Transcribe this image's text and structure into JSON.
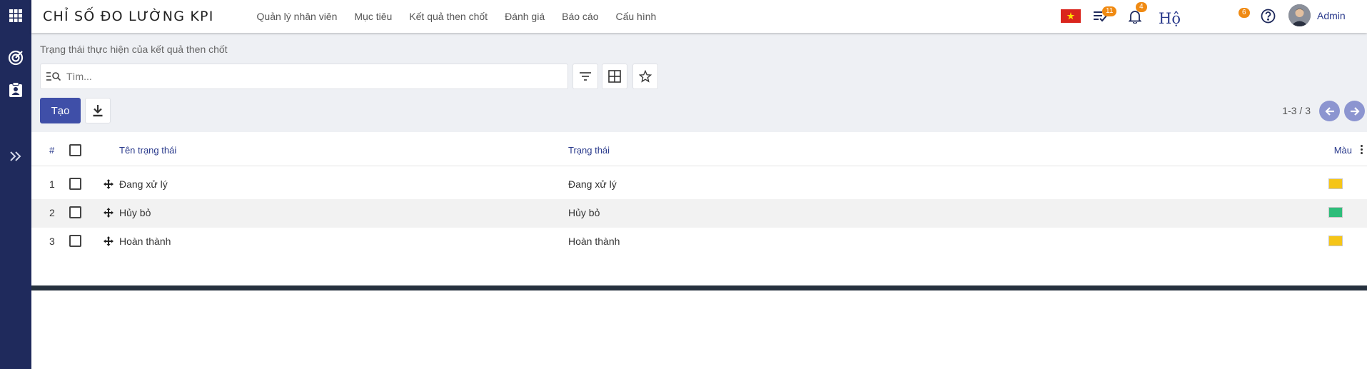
{
  "app_title": "CHỈ SỐ ĐO LƯỜNG KPI",
  "menu": [
    {
      "label": "Quản lý nhân viên"
    },
    {
      "label": "Mục tiêu"
    },
    {
      "label": "Kết quả then chốt"
    },
    {
      "label": "Đánh giá"
    },
    {
      "label": "Báo cáo"
    },
    {
      "label": "Cấu hình"
    }
  ],
  "topbar": {
    "activities_badge": "11",
    "notifications_badge": "4",
    "extra_text": "Hộ",
    "extra_badge": "6",
    "user_name": "Admin"
  },
  "breadcrumb": "Trạng thái thực hiện của kết quả then chốt",
  "search": {
    "placeholder": "Tìm...",
    "value": ""
  },
  "create_label": "Tạo",
  "pager": {
    "text": "1-3 / 3"
  },
  "columns": {
    "index": "#",
    "name": "Tên trạng thái",
    "state": "Trạng thái",
    "color": "Màu"
  },
  "rows": [
    {
      "index": "1",
      "name": "Đang xử lý",
      "state": "Đang xử lý",
      "color": "#f5c518"
    },
    {
      "index": "2",
      "name": "Hủy bỏ",
      "state": "Hủy bỏ",
      "color": "#2ebd7a"
    },
    {
      "index": "3",
      "name": "Hoàn thành",
      "state": "Hoàn thành",
      "color": "#f5c518"
    }
  ],
  "colors": {
    "sidebar": "#1f2a5c",
    "primary": "#3f4fa8",
    "badge": "#f08a12",
    "footer": "#26313e"
  },
  "icons": {
    "sidebar": [
      "apps-grid-icon",
      "target-icon",
      "clipboard-user-icon",
      "double-chevron-right-icon"
    ],
    "topbar": [
      "vietnam-flag-icon",
      "activity-check-icon",
      "bell-icon",
      "help-icon",
      "avatar"
    ]
  }
}
